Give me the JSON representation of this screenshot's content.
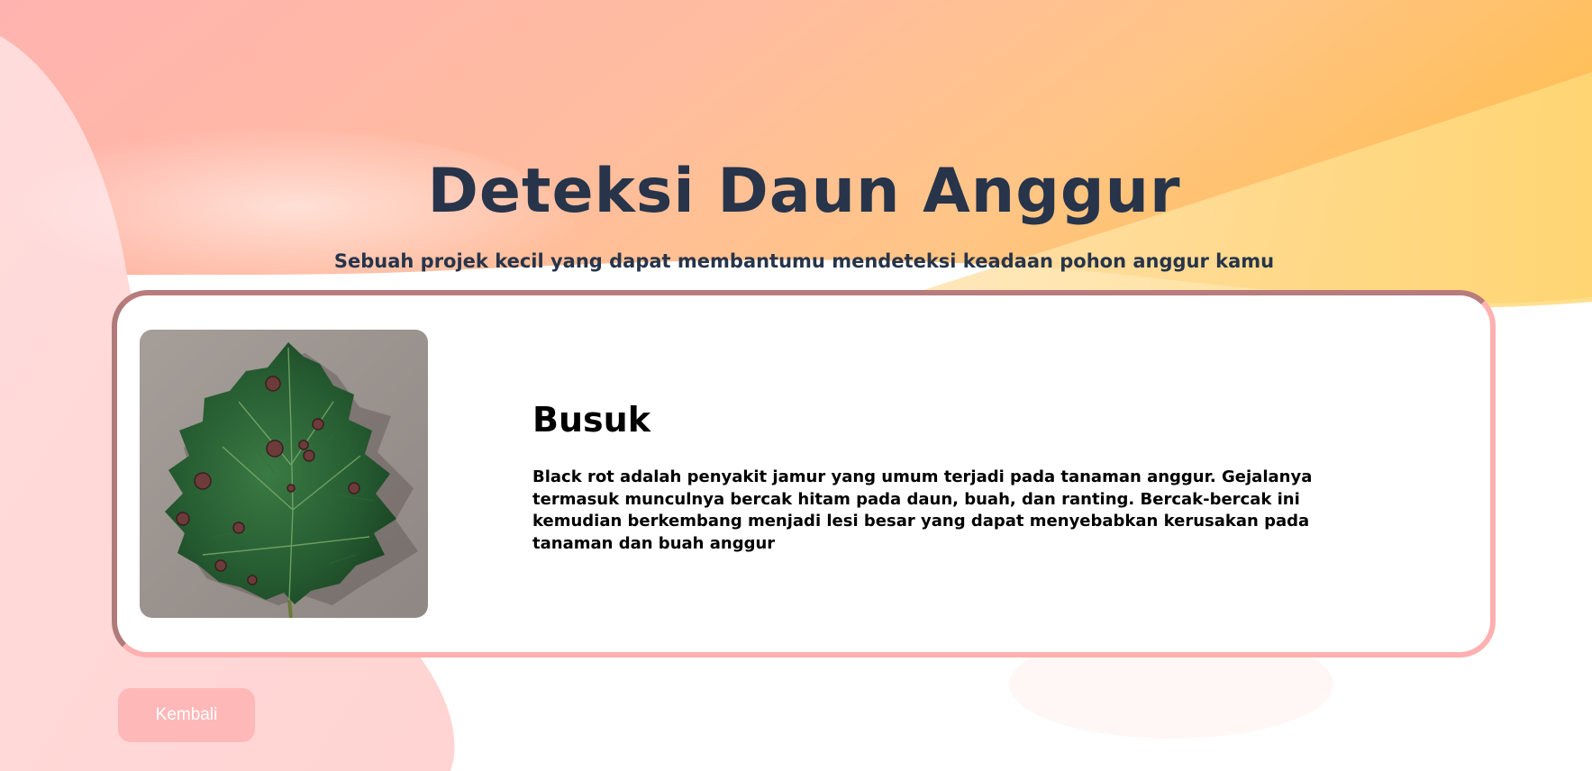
{
  "header": {
    "title": "Deteksi Daun Anggur",
    "subtitle": "Sebuah projek kecil yang dapat membantumu mendeteksi keadaan pohon anggur kamu"
  },
  "result": {
    "image_icon": "grape-leaf-image",
    "title": "Busuk",
    "description": "Black rot adalah penyakit jamur yang umum terjadi pada tanaman anggur. Gejalanya termasuk munculnya bercak hitam pada daun, buah, dan ranting. Bercak-bercak ini kemudian berkembang menjadi lesi besar yang dapat menyebabkan kerusakan pada tanaman dan buah anggur"
  },
  "actions": {
    "back_label": "Kembali"
  },
  "colors": {
    "title_text": "#27344a",
    "card_border": "#ffb0b0",
    "button_bg": "#ffb8b8",
    "gradient_pink": "#ffc0c0",
    "gradient_orange": "#ffbe5c",
    "gradient_yellow": "#ffd87a"
  }
}
